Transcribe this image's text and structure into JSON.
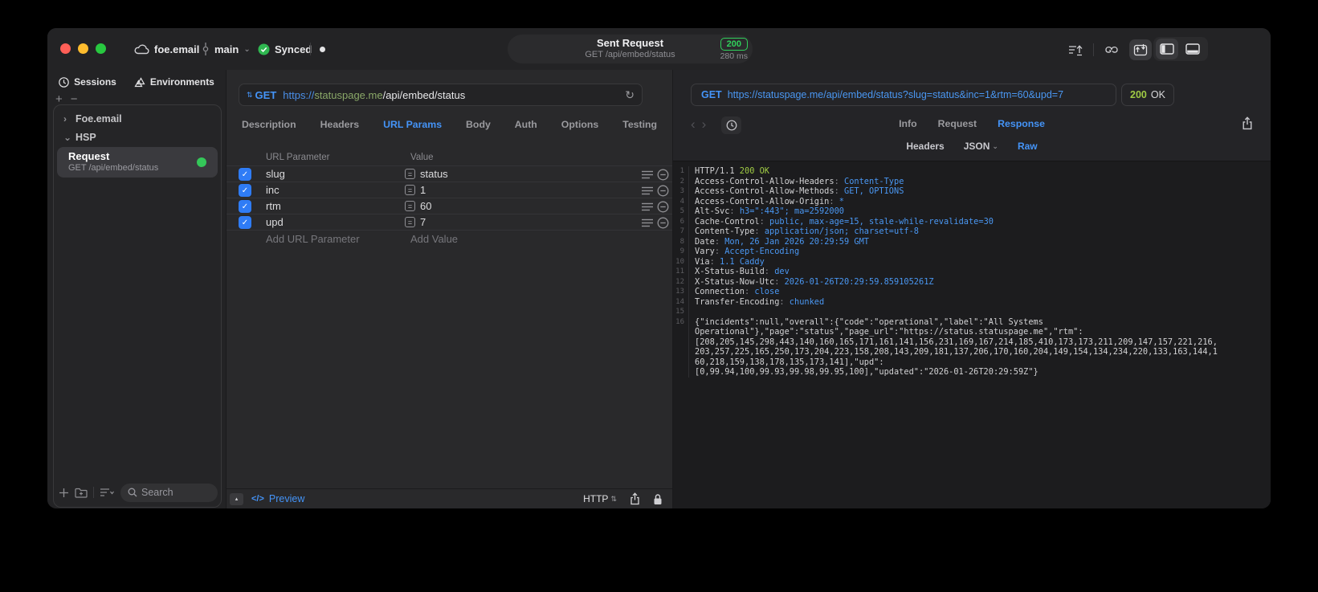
{
  "glyphs": {
    "check": "✓",
    "refresh": "↻",
    "updown": "⇅",
    "sort_updown": "⇅",
    "tri_up": "▴",
    "code": "</>",
    "chev_left": "‹",
    "chev_right": "›",
    "chev_down": "⌄",
    "plus_minus": "+−",
    "equals": "="
  },
  "colors": {
    "accent_blue": "#4494f8",
    "badge_green": "#30d15b",
    "status_lime": "#9fcb44",
    "checkbox_blue": "#2f7cf6",
    "online_green": "#34c759"
  },
  "titlebar": {
    "project": "foe.email",
    "branch": "main",
    "sync_label": "Synced",
    "request_summary": {
      "title": "Sent Request",
      "subtitle": "GET /api/embed/status",
      "status_code": "200",
      "duration": "280 ms"
    }
  },
  "sidebar": {
    "tabs": [
      {
        "label": "Sessions"
      },
      {
        "label": "Environments"
      }
    ],
    "tree": [
      {
        "label": "Foe.email",
        "expanded": false
      },
      {
        "label": "HSP",
        "expanded": true
      }
    ],
    "request_item": {
      "title": "Request",
      "subtitle": "GET /api/embed/status"
    },
    "search_placeholder": "Search"
  },
  "request_editor": {
    "method": "GET",
    "url": {
      "scheme": "https://",
      "host": "statuspage.me",
      "path": "/api/embed/status"
    },
    "tabs": [
      {
        "label": "Description",
        "active": false
      },
      {
        "label": "Headers",
        "active": false
      },
      {
        "label": "URL Params",
        "active": true
      },
      {
        "label": "Body",
        "active": false
      },
      {
        "label": "Auth",
        "active": false
      },
      {
        "label": "Options",
        "active": false
      },
      {
        "label": "Testing",
        "active": false
      }
    ],
    "params": {
      "columns": [
        "URL Parameter",
        "Value"
      ],
      "rows": [
        {
          "name": "slug",
          "value": "status",
          "enabled": true
        },
        {
          "name": "inc",
          "value": "1",
          "enabled": true
        },
        {
          "name": "rtm",
          "value": "60",
          "enabled": true
        },
        {
          "name": "upd",
          "value": "7",
          "enabled": true
        }
      ],
      "add_name_placeholder": "Add URL Parameter",
      "add_value_placeholder": "Add Value"
    },
    "footer": {
      "preview_label": "Preview",
      "protocol": "HTTP"
    }
  },
  "response_viewer": {
    "request_line": {
      "method": "GET",
      "url": "https://statuspage.me/api/embed/status?slug=status&inc=1&rtm=60&upd=7"
    },
    "status": {
      "code": "200",
      "text": "OK"
    },
    "tabs": [
      {
        "label": "Info",
        "active": false
      },
      {
        "label": "Request",
        "active": false
      },
      {
        "label": "Response",
        "active": true
      }
    ],
    "subtabs": [
      {
        "label": "Headers",
        "active": false,
        "dropdown": false
      },
      {
        "label": "JSON",
        "active": false,
        "dropdown": true
      },
      {
        "label": "Raw",
        "active": true,
        "dropdown": false
      }
    ],
    "lines": [
      {
        "n": "1",
        "parts": [
          {
            "t": "HTTP/1.1 ",
            "c": "p"
          },
          {
            "t": "200 OK",
            "c": "g"
          }
        ]
      },
      {
        "n": "2",
        "parts": [
          {
            "t": "Access-Control-Allow-Headers",
            "c": "p"
          },
          {
            "t": ": ",
            "c": "d"
          },
          {
            "t": "Content-Type",
            "c": "b"
          }
        ]
      },
      {
        "n": "3",
        "parts": [
          {
            "t": "Access-Control-Allow-Methods",
            "c": "p"
          },
          {
            "t": ": ",
            "c": "d"
          },
          {
            "t": "GET, OPTIONS",
            "c": "b"
          }
        ]
      },
      {
        "n": "4",
        "parts": [
          {
            "t": "Access-Control-Allow-Origin",
            "c": "p"
          },
          {
            "t": ": ",
            "c": "d"
          },
          {
            "t": "*",
            "c": "b"
          }
        ]
      },
      {
        "n": "5",
        "parts": [
          {
            "t": "Alt-Svc",
            "c": "p"
          },
          {
            "t": ": ",
            "c": "d"
          },
          {
            "t": "h3=\":443\"; ma=2592000",
            "c": "b"
          }
        ]
      },
      {
        "n": "6",
        "parts": [
          {
            "t": "Cache-Control",
            "c": "p"
          },
          {
            "t": ": ",
            "c": "d"
          },
          {
            "t": "public, max-age=15, stale-while-revalidate=30",
            "c": "b"
          }
        ]
      },
      {
        "n": "7",
        "parts": [
          {
            "t": "Content-Type",
            "c": "p"
          },
          {
            "t": ": ",
            "c": "d"
          },
          {
            "t": "application/json; charset=utf-8",
            "c": "b"
          }
        ]
      },
      {
        "n": "8",
        "parts": [
          {
            "t": "Date",
            "c": "p"
          },
          {
            "t": ": ",
            "c": "d"
          },
          {
            "t": "Mon, 26 Jan 2026 20:29:59 GMT",
            "c": "b"
          }
        ]
      },
      {
        "n": "9",
        "parts": [
          {
            "t": "Vary",
            "c": "p"
          },
          {
            "t": ": ",
            "c": "d"
          },
          {
            "t": "Accept-Encoding",
            "c": "b"
          }
        ]
      },
      {
        "n": "10",
        "parts": [
          {
            "t": "Via",
            "c": "p"
          },
          {
            "t": ": ",
            "c": "d"
          },
          {
            "t": "1.1 Caddy",
            "c": "b"
          }
        ]
      },
      {
        "n": "11",
        "parts": [
          {
            "t": "X-Status-Build",
            "c": "p"
          },
          {
            "t": ": ",
            "c": "d"
          },
          {
            "t": "dev",
            "c": "b"
          }
        ]
      },
      {
        "n": "12",
        "parts": [
          {
            "t": "X-Status-Now-Utc",
            "c": "p"
          },
          {
            "t": ": ",
            "c": "d"
          },
          {
            "t": "2026-01-26T20:29:59.859105261Z",
            "c": "b"
          }
        ]
      },
      {
        "n": "13",
        "parts": [
          {
            "t": "Connection",
            "c": "p"
          },
          {
            "t": ": ",
            "c": "d"
          },
          {
            "t": "close",
            "c": "b"
          }
        ]
      },
      {
        "n": "14",
        "parts": [
          {
            "t": "Transfer-Encoding",
            "c": "p"
          },
          {
            "t": ": ",
            "c": "d"
          },
          {
            "t": "chunked",
            "c": "b"
          }
        ]
      },
      {
        "n": "15",
        "parts": []
      },
      {
        "n": "16",
        "parts": [
          {
            "t": "{\"incidents\":null,\"overall\":{\"code\":\"operational\",\"label\":\"All Systems",
            "c": "p"
          }
        ]
      },
      {
        "n": "",
        "parts": [
          {
            "t": "Operational\"},\"page\":\"status\",\"page_url\":\"https://status.statuspage.me\",\"rtm\":",
            "c": "p"
          }
        ]
      },
      {
        "n": "",
        "parts": [
          {
            "t": "[208,205,145,298,443,140,160,165,171,161,141,156,231,169,167,214,185,410,173,173,211,209,147,157,221,216,",
            "c": "p"
          }
        ]
      },
      {
        "n": "",
        "parts": [
          {
            "t": "203,257,225,165,250,173,204,223,158,208,143,209,181,137,206,170,160,204,149,154,134,234,220,133,163,144,1",
            "c": "p"
          }
        ]
      },
      {
        "n": "",
        "parts": [
          {
            "t": "60,218,159,138,178,135,173,141],\"upd\":",
            "c": "p"
          }
        ]
      },
      {
        "n": "",
        "parts": [
          {
            "t": "[0,99.94,100,99.93,99.98,99.95,100],\"updated\":\"2026-01-26T20:29:59Z\"}",
            "c": "p"
          }
        ]
      }
    ]
  }
}
